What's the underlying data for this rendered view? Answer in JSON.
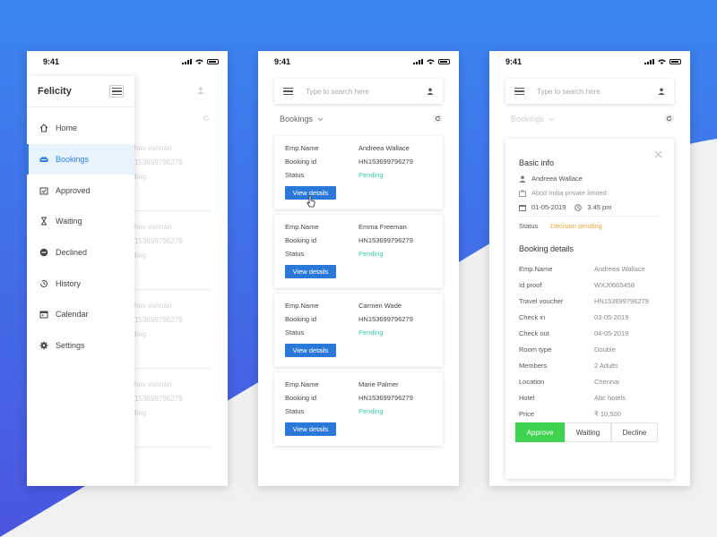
{
  "status_time": "9:41",
  "colors": {
    "accent": "#2a79d8",
    "pending": "#3cc9a4",
    "decision": "#f2a63a",
    "approve": "#3fd24f",
    "bg_blue": "#3a7bea"
  },
  "phone1": {
    "brand": "Felicity",
    "nav": [
      {
        "label": "Home",
        "icon": "home-icon"
      },
      {
        "label": "Bookings",
        "icon": "sofa-icon"
      },
      {
        "label": "Approved",
        "icon": "calendar-check-icon"
      },
      {
        "label": "Waiting",
        "icon": "hourglass-icon"
      },
      {
        "label": "Declined",
        "icon": "minus-circle-icon"
      },
      {
        "label": "History",
        "icon": "history-icon"
      },
      {
        "label": "Calendar",
        "icon": "calendar-icon"
      },
      {
        "label": "Settings",
        "icon": "gear-icon"
      }
    ],
    "ghost_rows": [
      [
        "ihav vannan",
        "I153699796279",
        "ding"
      ],
      [
        "ihav vannan",
        "I153699796279",
        "ding"
      ],
      [
        "ihav vannan",
        "I153699796279",
        "ding"
      ],
      [
        "ihav vannan",
        "I153699796279",
        "ding"
      ]
    ]
  },
  "search": {
    "placeholder": "Type to search here"
  },
  "filter_label": "Bookings",
  "labels": {
    "emp_name": "Emp.Name",
    "booking_id": "Booking id",
    "status": "Status",
    "view_details": "View details"
  },
  "bookings": [
    {
      "name": "Andreea Wallace",
      "id": "HN153699796279",
      "status": "Pending"
    },
    {
      "name": "Emma Freeman",
      "id": "HN153699796279",
      "status": "Pending"
    },
    {
      "name": "Carmen Wade",
      "id": "HN153699796279",
      "status": "Pending"
    },
    {
      "name": "Marie Palmer",
      "id": "HN153699796279",
      "status": "Pending"
    }
  ],
  "detail": {
    "basic_title": "Basic info",
    "name": "Andreea Wallace",
    "company": "Abcd India private limited",
    "date": "01-05-2019",
    "time": "3.45 pm",
    "status_label": "Status",
    "status_value": "Decision pending",
    "booking_title": "Booking details",
    "rows": [
      {
        "k": "Emp.Name",
        "v": "Andreea Wallace"
      },
      {
        "k": "Id proof",
        "v": "WXJ0665458"
      },
      {
        "k": "Travel voucher",
        "v": "HN153699796279"
      },
      {
        "k": "Check in",
        "v": "03-05-2019"
      },
      {
        "k": "Check out",
        "v": "04-05-2019"
      },
      {
        "k": "Room type",
        "v": "Double"
      },
      {
        "k": "Members",
        "v": "2 Adults"
      },
      {
        "k": "Location",
        "v": "Chennai"
      },
      {
        "k": "Hotel",
        "v": "Abc hotels"
      },
      {
        "k": "Price",
        "v": "₹ 10,500"
      }
    ],
    "actions": {
      "approve": "Approve",
      "waiting": "Waiting",
      "decline": "Decline"
    }
  }
}
